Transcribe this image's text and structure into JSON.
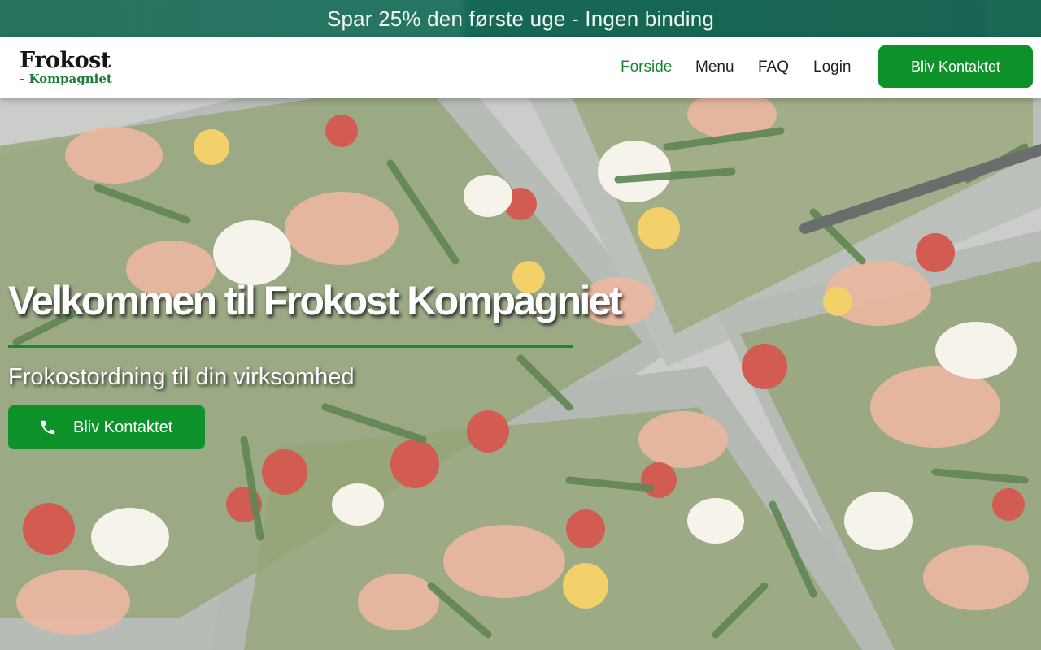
{
  "promo": {
    "text": "Spar 25% den første uge - Ingen binding"
  },
  "logo": {
    "line1": "Frokost",
    "line2": "- Kompagniet"
  },
  "nav": {
    "items": [
      {
        "label": "Forside",
        "active": true
      },
      {
        "label": "Menu",
        "active": false
      },
      {
        "label": "FAQ",
        "active": false
      },
      {
        "label": "Login",
        "active": false
      }
    ],
    "cta_label": "Bliv Kontaktet"
  },
  "hero": {
    "title": "Velkommen til Frokost Kompagniet",
    "subtitle": "Frokostordning til din virksomhed",
    "cta_label": "Bliv Kontaktet",
    "cta_icon": "phone-icon"
  },
  "colors": {
    "brand_green": "#0d922a",
    "active_link": "#15892f",
    "promo_bg": "#1a6b56"
  }
}
